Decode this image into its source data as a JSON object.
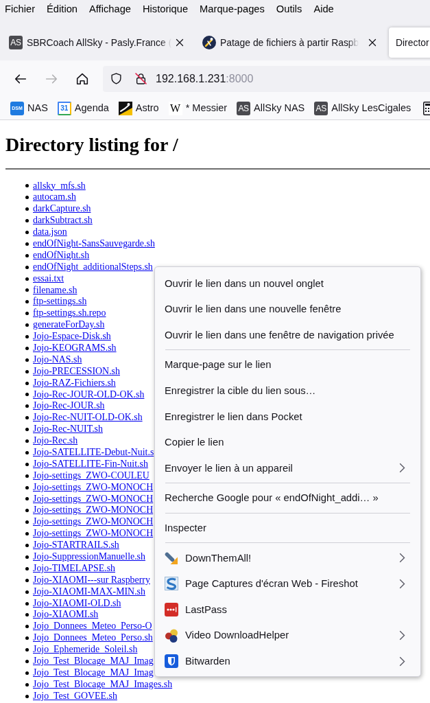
{
  "menu_bar": [
    "Fichier",
    "Édition",
    "Affichage",
    "Historique",
    "Marque-pages",
    "Outils",
    "Aide"
  ],
  "tabs": [
    {
      "title": "SBRCoach AllSky - Pasly.France (",
      "icon_text": "AS",
      "close_button": true,
      "selected": false
    },
    {
      "title": "Patage de fichiers à partir Raspb",
      "close_button": true,
      "selected": false
    },
    {
      "title": "Director",
      "close_button": false,
      "selected": true
    }
  ],
  "nav_buttons": [
    {
      "kind": "back",
      "disabled": false
    },
    {
      "kind": "forward",
      "disabled": true
    },
    {
      "kind": "home",
      "disabled": false
    }
  ],
  "address_bar": {
    "host": "192.168.1.231",
    "port": ":8000"
  },
  "bookmarks": [
    {
      "label": "NAS",
      "icon_text": "DSM"
    },
    {
      "label": "Agenda",
      "icon_text": "31"
    },
    {
      "label": "Astro"
    },
    {
      "label": "* Messier",
      "icon_text": "W"
    },
    {
      "label": "AllSky NAS",
      "icon_text": "AS"
    },
    {
      "label": "AllSky LesCigales",
      "icon_text": "AS"
    }
  ],
  "page": {
    "heading": "Directory listing for /",
    "files": [
      "allsky_mfs.sh",
      "autocam.sh",
      "darkCapture.sh",
      "darkSubtract.sh",
      "data.json",
      "endOfNight-SansSauvegarde.sh",
      "endOfNight.sh",
      "endOfNight_additionalSteps.sh",
      "essai.txt",
      "filename.sh",
      "ftp-settings.sh",
      "ftp-settings.sh.repo",
      "generateForDay.sh",
      "Jojo-Espace-Disk.sh",
      "Jojo-KEOGRAMS.sh",
      "Jojo-NAS.sh",
      "Jojo-PRECESSION.sh",
      "Jojo-RAZ-Fichiers.sh",
      "Jojo-Rec-JOUR-OLD-OK.sh",
      "Jojo-Rec-JOUR.sh",
      "Jojo-Rec-NUIT-OLD-OK.sh",
      "Jojo-Rec-NUIT.sh",
      "Jojo-Rec.sh",
      "Jojo-SATELLITE-Debut-Nuit.s",
      "Jojo-SATELLITE-Fin-Nuit.sh",
      "Jojo-settings_ZWO-COULEU",
      "Jojo-settings_ZWO-MONOCH",
      "Jojo-settings_ZWO-MONOCH",
      "Jojo-settings_ZWO-MONOCH",
      "Jojo-settings_ZWO-MONOCH",
      "Jojo-settings_ZWO-MONOCH",
      "Jojo-STARTRAILS.sh",
      "Jojo-SuppressionManuelle.sh",
      "Jojo-TIMELAPSE.sh",
      "Jojo-XIAOMI---sur Raspberry",
      "Jojo-XIAOMI-MAX-MIN.sh",
      "Jojo-XIAOMI-OLD.sh",
      "Jojo-XIAOMI.sh",
      "Jojo_Donnees_Meteo_Perso-O",
      "Jojo_Donnees_Meteo_Perso.sh",
      "Jojo_Ephemeride_Soleil.sh",
      "Jojo_Test_Blocage_MAJ_Imag",
      "Jojo_Test_Blocage_MAJ_Imag",
      "Jojo_Test_Blocage_MAJ_Images.sh",
      "Jojo_Test_GOVEE.sh"
    ]
  },
  "context_menu": {
    "items": [
      {
        "kind": "command",
        "label": "Ouvrir le lien dans un nouvel onglet",
        "submenu": false
      },
      {
        "kind": "command",
        "label": "Ouvrir le lien dans une nouvelle fenêtre",
        "submenu": false
      },
      {
        "kind": "command",
        "label": "Ouvrir le lien dans une fenêtre de navigation privée",
        "submenu": false
      },
      {
        "kind": "separator"
      },
      {
        "kind": "command",
        "label": "Marque-page sur le lien",
        "submenu": false
      },
      {
        "kind": "command",
        "label": "Enregistrer la cible du lien sous…",
        "submenu": false
      },
      {
        "kind": "command",
        "label": "Enregistrer le lien dans Pocket",
        "submenu": false
      },
      {
        "kind": "command",
        "label": "Copier le lien",
        "submenu": false
      },
      {
        "kind": "command",
        "label": "Envoyer le lien à un appareil",
        "submenu": true
      },
      {
        "kind": "separator"
      },
      {
        "kind": "command",
        "label": "Recherche Google pour « endOfNight_addi… »",
        "submenu": false
      },
      {
        "kind": "separator"
      },
      {
        "kind": "command",
        "label": "Inspecter",
        "submenu": false
      },
      {
        "kind": "separator"
      },
      {
        "kind": "extension",
        "label": "DownThemAll!",
        "submenu": true
      },
      {
        "kind": "extension",
        "label": "Page Captures d'écran Web - Fireshot",
        "submenu": true
      },
      {
        "kind": "extension",
        "label": "LastPass",
        "submenu": false
      },
      {
        "kind": "extension",
        "label": "Video DownloadHelper",
        "submenu": true
      },
      {
        "kind": "extension",
        "label": "Bitwarden",
        "submenu": true
      }
    ]
  }
}
